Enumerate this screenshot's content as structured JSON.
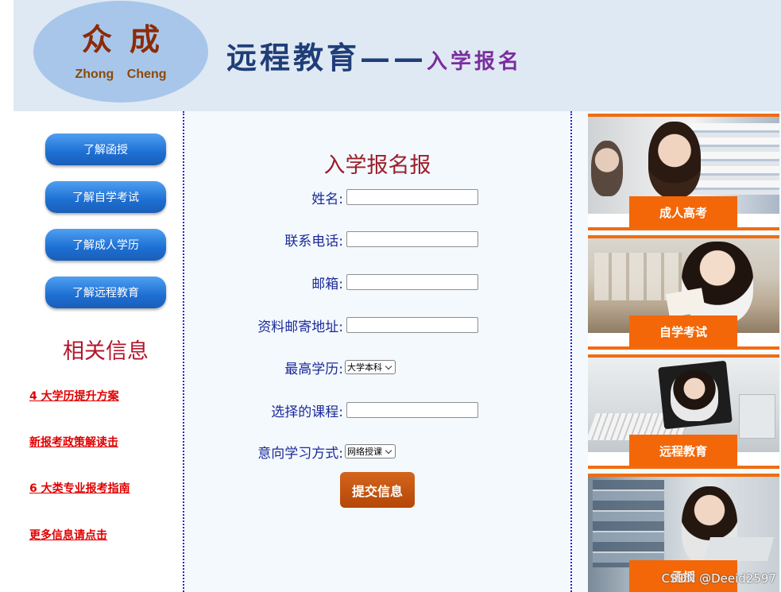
{
  "logo": {
    "cn": "众成",
    "en": "Zhong Cheng"
  },
  "header": {
    "title_main": "远程教育——",
    "title_sub": "入学报名"
  },
  "nav": {
    "items": [
      {
        "label": "了解函授"
      },
      {
        "label": "了解自学考试"
      },
      {
        "label": "了解成人学历"
      },
      {
        "label": "了解远程教育"
      }
    ]
  },
  "related": {
    "title": "相关信息",
    "links": [
      {
        "label": "4 大学历提升方案"
      },
      {
        "label": "新报考政策解读击"
      },
      {
        "label": "6 大类专业报考指南"
      },
      {
        "label": "更多信息请点击"
      }
    ]
  },
  "form": {
    "title": "入学报名报",
    "fields": [
      {
        "label": "姓名:",
        "value": ""
      },
      {
        "label": "联系电话:",
        "value": ""
      },
      {
        "label": "邮箱:",
        "value": ""
      },
      {
        "label": "资料邮寄地址:",
        "value": ""
      },
      {
        "label": "最高学历:",
        "selected": "大学本科"
      },
      {
        "label": "选择的课程:",
        "value": ""
      },
      {
        "label": "意向学习方式:",
        "selected": "网络授课"
      }
    ],
    "submit_label": "提交信息"
  },
  "promos": [
    {
      "label": "成人高考"
    },
    {
      "label": "自学考试"
    },
    {
      "label": "远程教育"
    },
    {
      "label": "函授"
    }
  ],
  "watermark": "CSDN @Deeid2597",
  "colors": {
    "header_bg": "#dfe9f3",
    "logo_bg": "#a8c6ea",
    "nav_button": "#1d6fd3",
    "link_red": "#e00000",
    "label_blue": "#1b2a99",
    "accent_orange": "#f36708",
    "submit_brown": "#b54708"
  }
}
